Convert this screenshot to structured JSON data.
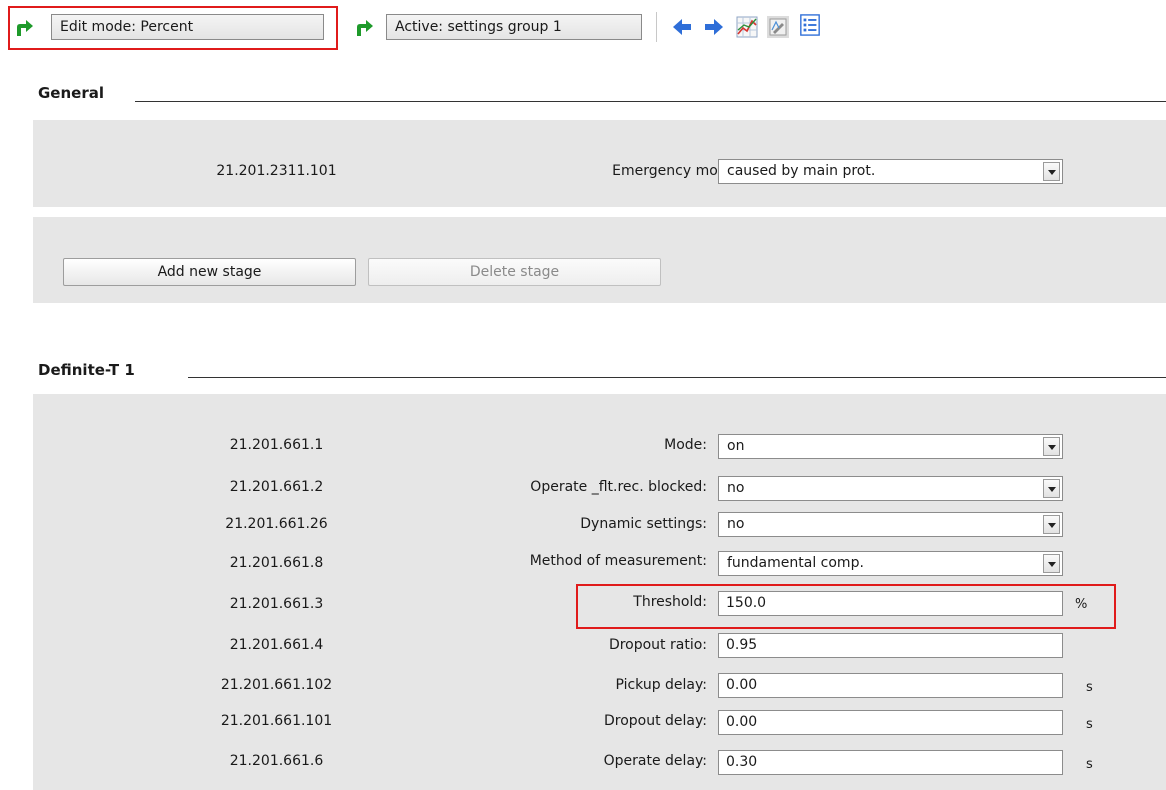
{
  "toolbar": {
    "edit_mode": "Edit mode: Percent",
    "active_group": "Active: settings group 1",
    "icons": [
      "green-arrow-icon",
      "back-arrow-icon",
      "forward-arrow-icon",
      "chart-icon",
      "edit-icon",
      "list-view-icon"
    ],
    "colors": {
      "arrow_green": "#1e9a2a",
      "nav_blue": "#2e6ed8",
      "highlight_red": "#e01b1b"
    }
  },
  "general": {
    "title": "General",
    "id": "21.201.2311.101",
    "label": "Emergency mode:",
    "value": "caused by main prot.",
    "add_stage": "Add new stage",
    "delete_stage": "Delete stage"
  },
  "definite": {
    "title": "Definite-T 1",
    "rows": [
      {
        "id": "21.201.661.1",
        "label": "Mode:",
        "value": "on",
        "kind": "dropdown",
        "unit": ""
      },
      {
        "id": "21.201.661.2",
        "label": "Operate _flt.rec. blocked:",
        "value": "no",
        "kind": "dropdown",
        "unit": ""
      },
      {
        "id": "21.201.661.26",
        "label": "Dynamic settings:",
        "value": "no",
        "kind": "dropdown",
        "unit": ""
      },
      {
        "id": "21.201.661.8",
        "label": "Method of measurement:",
        "value": "fundamental comp.",
        "kind": "dropdown",
        "unit": ""
      },
      {
        "id": "21.201.661.3",
        "label": "Threshold:",
        "value": "150.0",
        "kind": "text",
        "unit": "%"
      },
      {
        "id": "21.201.661.4",
        "label": "Dropout ratio:",
        "value": "0.95",
        "kind": "text",
        "unit": ""
      },
      {
        "id": "21.201.661.102",
        "label": "Pickup delay:",
        "value": "0.00",
        "kind": "text",
        "unit": "s"
      },
      {
        "id": "21.201.661.101",
        "label": "Dropout delay:",
        "value": "0.00",
        "kind": "text",
        "unit": "s"
      },
      {
        "id": "21.201.661.6",
        "label": "Operate delay:",
        "value": "0.30",
        "kind": "text",
        "unit": "s"
      }
    ]
  }
}
